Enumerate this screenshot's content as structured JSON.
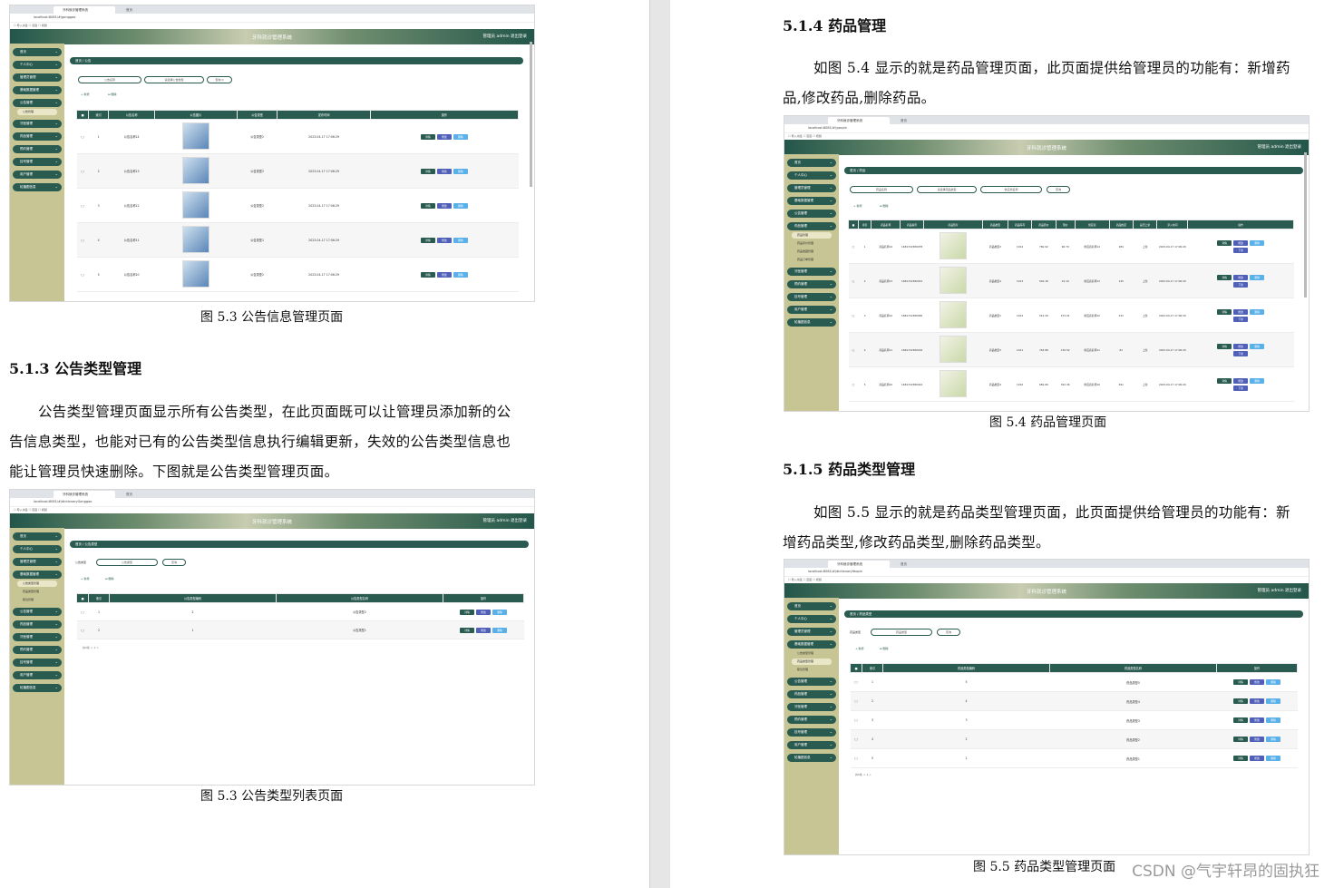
{
  "left_page": {
    "figure_a": {
      "caption": "图 5.3  公告信息管理页面",
      "browser_tab": "牙科就诊管理系统",
      "browser_tab2": "首页",
      "address": "localhost:8081/#/gonggao",
      "bookmarks": "☐ 导入书签   ☐ 百度   ☐ 视频",
      "app_title": "牙科就诊管理系统",
      "app_user": "管理员 admin   退出登录",
      "breadcrumb": "首页 / 公告",
      "search1": "公告名称",
      "search2": "请选择公告类型",
      "search_btn": "查询 Q",
      "add": "+ 新增",
      "del": "⊟ 删除",
      "sidebar": [
        "首页",
        "个人中心",
        "管理员管理",
        "基础数据管理",
        "公告管理",
        "牙医管理",
        "药品管理",
        "预约管理",
        "挂号管理",
        "用户管理",
        "轮播图信息"
      ],
      "sidebar_sub": "公告管理",
      "columns": [
        "索引",
        "公告名称",
        "公告图片",
        "公告类型",
        "发布时间",
        "操作"
      ],
      "rows": [
        {
          "i": "1",
          "name": "公告名称14",
          "type": "公告类型2",
          "time": "2023-04-17 17:06:29"
        },
        {
          "i": "2",
          "name": "公告名称13",
          "type": "公告类型2",
          "time": "2023-04-17 17:06:29"
        },
        {
          "i": "3",
          "name": "公告名称12",
          "type": "公告类型2",
          "time": "2023-04-17 17:06:29"
        },
        {
          "i": "4",
          "name": "公告名称11",
          "type": "公告类型1",
          "time": "2023-04-17 17:06:29"
        },
        {
          "i": "5",
          "name": "公告名称10",
          "type": "公告类型2",
          "time": "2023-04-17 17:06:29"
        }
      ],
      "ops": [
        "详情",
        "修改",
        "删除"
      ]
    },
    "heading_513": "5.1.3 公告类型管理",
    "para_513": [
      "公告类型管理页面显示所有公告类型，在此页面既可以让管理员添加新的公",
      "告信息类型，也能对已有的公告类型信息执行编辑更新，失效的公告类型信息也",
      "能让管理员快速删除。下图就是公告类型管理页面。"
    ],
    "figure_b": {
      "caption": "图 5.3  公告类型列表页面",
      "address": "localhost:8081/#/dictionaryGonggao",
      "breadcrumb": "首页 / 公告类型",
      "search_label": "公告类型",
      "search1": "公告类型",
      "search_btn": "查询",
      "sidebar_subs": [
        "公告类型管理",
        "药品类型管理",
        "职位管理"
      ],
      "columns": [
        "索引",
        "公告类型编码",
        "公告类型名称",
        "操作"
      ],
      "rows": [
        {
          "i": "1",
          "code": "2",
          "name": "公告类型2"
        },
        {
          "i": "2",
          "code": "1",
          "name": "公告类型1"
        }
      ],
      "pager": "共2条  < 1 >"
    }
  },
  "right_page": {
    "heading_514": "5.1.4  药品管理",
    "para_514": [
      "如图 5.4 显示的就是药品管理页面，此页面提供给管理员的功能有：新增药",
      "品,修改药品,删除药品。"
    ],
    "figure_c": {
      "caption": "图 5.4 药品管理页面",
      "address": "localhost:8081/#/yaopin",
      "breadcrumb": "首页 / 药品",
      "search1": "药品名称",
      "search2": "请选择药品类型",
      "search3": "供应商名称",
      "search_btn": "查询",
      "sidebar_subs": [
        "药品管理",
        "药品评价管理",
        "药品收藏管理",
        "药品订单管理"
      ],
      "columns": [
        "索引",
        "药品名称",
        "药品编号",
        "药品照片",
        "药品类型",
        "药品库存",
        "药品原价",
        "现价",
        "供应商",
        "药品热度",
        "是否上架",
        "录入时间",
        "操作"
      ],
      "rows": [
        {
          "i": "1",
          "name": "药品名称14",
          "no": "1681722380078",
          "type": "药品类型2",
          "stock": "1014",
          "price": "760.92",
          "now": "96.79",
          "sup": "供应商名称14",
          "hot": "284",
          "up": "上架",
          "time": "2023-04-17 17:06:29"
        },
        {
          "i": "2",
          "name": "药品名称13",
          "no": "1681722380023",
          "type": "药品类型4",
          "stock": "1013",
          "price": "549.18",
          "now": "24.19",
          "sup": "供应商名称13",
          "hot": "145",
          "up": "上架",
          "time": "2023-04-17 17:06:29"
        },
        {
          "i": "3",
          "name": "药品名称12",
          "no": "1681722380056",
          "type": "药品类型1",
          "stock": "1012",
          "price": "512.39",
          "now": "473.01",
          "sup": "供应商名称12",
          "hot": "231",
          "up": "上架",
          "time": "2023-04-17 17:06:29"
        },
        {
          "i": "4",
          "name": "药品名称11",
          "no": "1681722380204",
          "type": "药品类型3",
          "stock": "1011",
          "price": "763.88",
          "now": "130.52",
          "sup": "供应商名称11",
          "hot": "81",
          "up": "上架",
          "time": "2023-04-17 17:06:29"
        },
        {
          "i": "5",
          "name": "药品名称10",
          "no": "1681722380022",
          "type": "药品类型4",
          "stock": "1010",
          "price": "682.66",
          "now": "322.36",
          "sup": "供应商名称10",
          "hot": "491",
          "up": "上架",
          "time": "2023-04-17 17:06:29"
        }
      ],
      "ops_extra": "下架"
    },
    "heading_515": "5.1.5  药品类型管理",
    "para_515": [
      "如图 5.5 显示的就是药品类型管理页面，此页面提供给管理员的功能有：新",
      "增药品类型,修改药品类型,删除药品类型。"
    ],
    "figure_d": {
      "caption": "图 5.5  药品类型管理页面",
      "address": "localhost:8081/#/dictionaryYaopin",
      "breadcrumb": "首页 / 药品类型",
      "search_label": "药品类型",
      "search1": "药品类型",
      "search_btn": "查询",
      "columns": [
        "索引",
        "药品类型编码",
        "药品类型名称",
        "操作"
      ],
      "rows": [
        {
          "i": "1",
          "code": "5",
          "name": "药品类型5"
        },
        {
          "i": "2",
          "code": "4",
          "name": "药品类型4"
        },
        {
          "i": "3",
          "code": "3",
          "name": "药品类型3"
        },
        {
          "i": "4",
          "code": "2",
          "name": "药品类型2"
        },
        {
          "i": "5",
          "code": "1",
          "name": "药品类型1"
        }
      ],
      "pager": "共5条  < 1 >"
    }
  },
  "watermark": "CSDN @气宇轩昂的固执狂"
}
